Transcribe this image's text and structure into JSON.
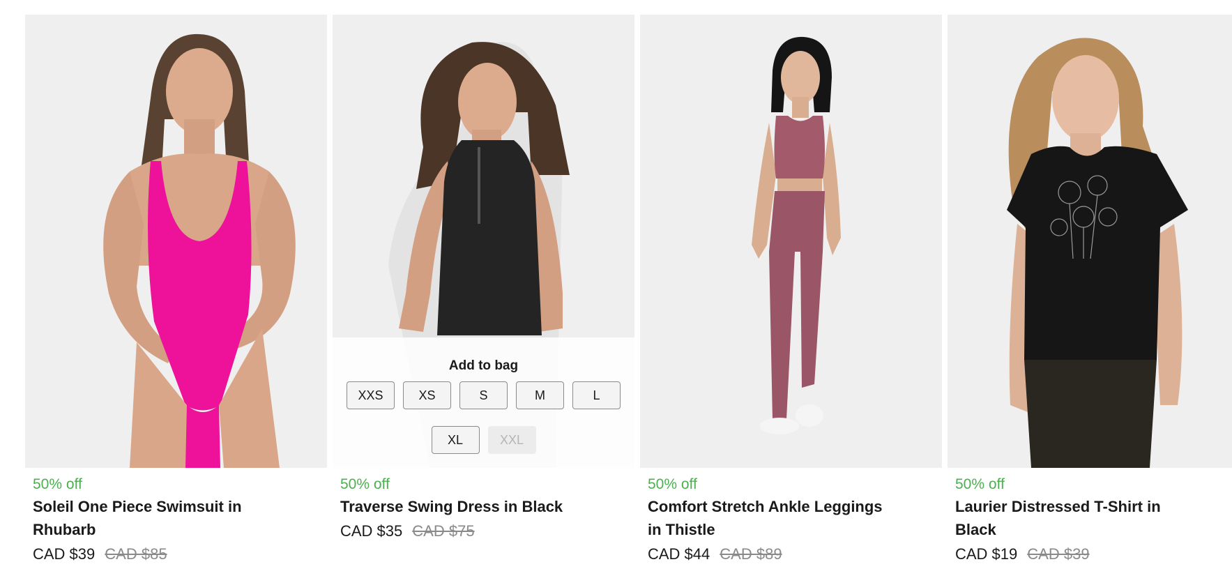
{
  "colors": {
    "discount_green": "#4caf50",
    "image_background": "#efefef",
    "compare_price_gray": "#8a8a8a"
  },
  "products": [
    {
      "image_alt": "model wearing pink one piece swimsuit",
      "discount": "50% off",
      "title": "Soleil One Piece Swimsuit in Rhubarb",
      "price": "CAD $39",
      "compare_price": "CAD $85"
    },
    {
      "image_alt": "model wearing black swing dress",
      "discount": "50% off",
      "title": "Traverse Swing Dress in Black",
      "price": "CAD $35",
      "compare_price": "CAD $75",
      "quick_add": {
        "title": "Add to bag",
        "sizes": [
          {
            "label": "XXS",
            "available": true
          },
          {
            "label": "XS",
            "available": true
          },
          {
            "label": "S",
            "available": true
          },
          {
            "label": "M",
            "available": true
          },
          {
            "label": "L",
            "available": true
          },
          {
            "label": "XL",
            "available": true
          },
          {
            "label": "XXL",
            "available": false
          }
        ]
      }
    },
    {
      "image_alt": "model wearing thistle tank and ankle leggings",
      "discount": "50% off",
      "title": "Comfort Stretch Ankle Leggings in Thistle",
      "price": "CAD $44",
      "compare_price": "CAD $89"
    },
    {
      "image_alt": "model wearing black distressed t-shirt",
      "discount": "50% off",
      "title": "Laurier Distressed T-Shirt in Black",
      "price": "CAD $19",
      "compare_price": "CAD $39"
    }
  ]
}
